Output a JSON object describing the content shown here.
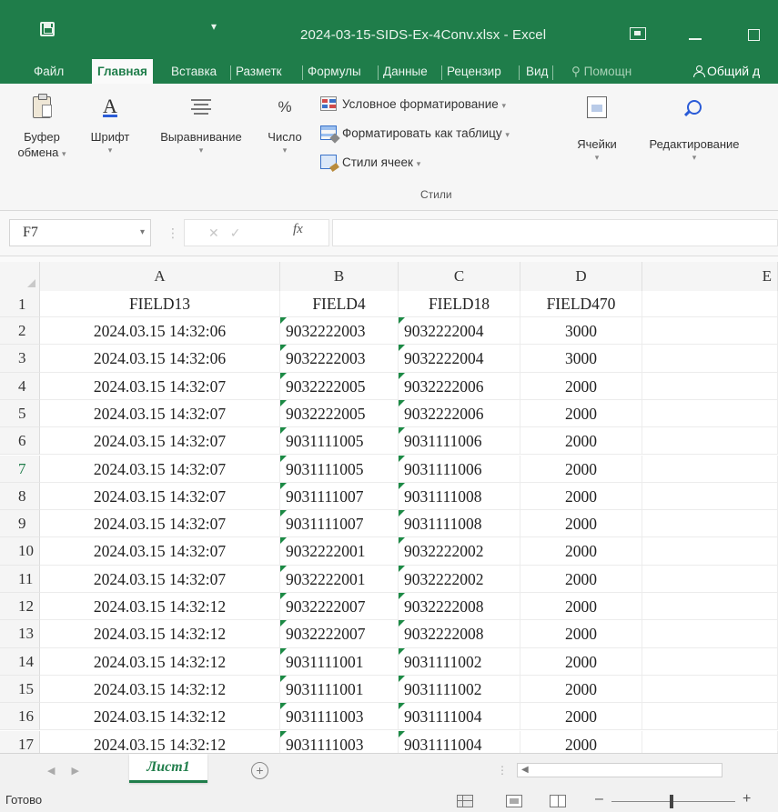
{
  "window": {
    "filename": "2024-03-15-SIDS-Ex-4Conv.xlsx - Excel"
  },
  "tabs": [
    {
      "label": "Файл",
      "active": false
    },
    {
      "label": "Главная",
      "active": true
    },
    {
      "label": "Вставка",
      "active": false
    },
    {
      "label": "Разметк",
      "active": false
    },
    {
      "label": "Формулы",
      "active": false
    },
    {
      "label": "Данные",
      "active": false
    },
    {
      "label": "Рецензир",
      "active": false
    },
    {
      "label": "Вид",
      "active": false
    }
  ],
  "tell_me": "Помощн",
  "share": "Общий д",
  "ribbon": {
    "clipboard_line1": "Буфер",
    "clipboard_line2": "обмена",
    "font": "Шрифт",
    "alignment": "Выравнивание",
    "number": "Число",
    "conditional_formatting": "Условное форматирование",
    "format_as_table": "Форматировать как таблицу",
    "cell_styles": "Стили ячеек",
    "styles_group": "Стили",
    "cells": "Ячейки",
    "editing": "Редактирование"
  },
  "formula_bar": {
    "name_box": "F7",
    "fx": "fx",
    "value": ""
  },
  "columns": [
    "A",
    "B",
    "C",
    "D",
    "E"
  ],
  "header_row": {
    "row": "1",
    "a": "FIELD13",
    "b": "FIELD4",
    "c": "FIELD18",
    "d": "FIELD470"
  },
  "rows": [
    {
      "row": "2",
      "a": "2024.03.15 14:32:06",
      "b": "9032222003",
      "c": "9032222004",
      "d": "3000"
    },
    {
      "row": "3",
      "a": "2024.03.15 14:32:06",
      "b": "9032222003",
      "c": "9032222004",
      "d": "3000"
    },
    {
      "row": "4",
      "a": "2024.03.15 14:32:07",
      "b": "9032222005",
      "c": "9032222006",
      "d": "2000"
    },
    {
      "row": "5",
      "a": "2024.03.15 14:32:07",
      "b": "9032222005",
      "c": "9032222006",
      "d": "2000"
    },
    {
      "row": "6",
      "a": "2024.03.15 14:32:07",
      "b": "9031111005",
      "c": "9031111006",
      "d": "2000"
    },
    {
      "row": "7",
      "a": "2024.03.15 14:32:07",
      "b": "9031111005",
      "c": "9031111006",
      "d": "2000"
    },
    {
      "row": "8",
      "a": "2024.03.15 14:32:07",
      "b": "9031111007",
      "c": "9031111008",
      "d": "2000"
    },
    {
      "row": "9",
      "a": "2024.03.15 14:32:07",
      "b": "9031111007",
      "c": "9031111008",
      "d": "2000"
    },
    {
      "row": "10",
      "a": "2024.03.15 14:32:07",
      "b": "9032222001",
      "c": "9032222002",
      "d": "2000"
    },
    {
      "row": "11",
      "a": "2024.03.15 14:32:07",
      "b": "9032222001",
      "c": "9032222002",
      "d": "2000"
    },
    {
      "row": "12",
      "a": "2024.03.15 14:32:12",
      "b": "9032222007",
      "c": "9032222008",
      "d": "2000"
    },
    {
      "row": "13",
      "a": "2024.03.15 14:32:12",
      "b": "9032222007",
      "c": "9032222008",
      "d": "2000"
    },
    {
      "row": "14",
      "a": "2024.03.15 14:32:12",
      "b": "9031111001",
      "c": "9031111002",
      "d": "2000"
    },
    {
      "row": "15",
      "a": "2024.03.15 14:32:12",
      "b": "9031111001",
      "c": "9031111002",
      "d": "2000"
    },
    {
      "row": "16",
      "a": "2024.03.15 14:32:12",
      "b": "9031111003",
      "c": "9031111004",
      "d": "2000"
    },
    {
      "row": "17",
      "a": "2024.03.15 14:32:12",
      "b": "9031111003",
      "c": "9031111004",
      "d": "2000"
    }
  ],
  "selected_row": "7",
  "sheet": {
    "name": "Лист1"
  },
  "status": "Готово",
  "colors": {
    "accent": "#1f7d4a",
    "text_number_marker": "#1c8a45"
  }
}
